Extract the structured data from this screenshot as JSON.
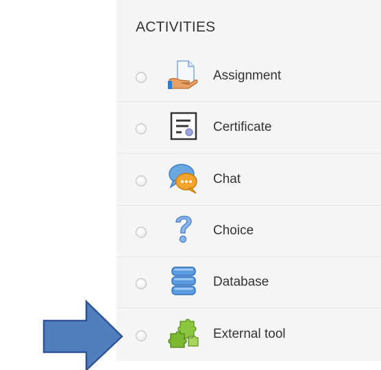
{
  "panel": {
    "title": "ACTIVITIES",
    "items": [
      {
        "label": "Assignment",
        "icon": "assignment-icon"
      },
      {
        "label": "Certificate",
        "icon": "certificate-icon"
      },
      {
        "label": "Chat",
        "icon": "chat-icon"
      },
      {
        "label": "Choice",
        "icon": "choice-icon"
      },
      {
        "label": "Database",
        "icon": "database-icon"
      },
      {
        "label": "External tool",
        "icon": "external-tool-icon"
      }
    ]
  },
  "colors": {
    "panel_bg": "#f5f5f5",
    "text": "#333333",
    "arrow_fill": "#4f7fbf",
    "arrow_stroke": "#2f5597"
  }
}
